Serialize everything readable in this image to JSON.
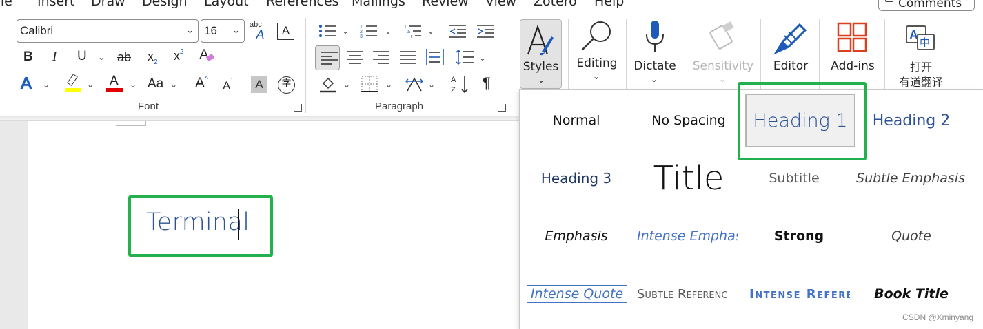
{
  "tabs": [
    "File",
    "Insert",
    "Draw",
    "Design",
    "Layout",
    "References",
    "Mailings",
    "Review",
    "View",
    "Zotero",
    "Help"
  ],
  "comments_label": "Comments",
  "font": {
    "name": "Calibri",
    "size": "16",
    "group_label": "Font",
    "bold": "B",
    "italic": "I",
    "underline": "U",
    "strike": "ab",
    "subscript": "x",
    "subscript_mark": "2",
    "superscript": "x",
    "superscript_mark": "2",
    "change_case": "Aa",
    "grow": "A",
    "shrink": "A",
    "char_shading": "A",
    "enclose": "字",
    "clear_format": "A",
    "text_effects": "A",
    "font_color": "A",
    "phonetic_top": "abc",
    "phonetic_bottom": "A",
    "char_border": "A"
  },
  "paragraph": {
    "group_label": "Paragraph",
    "show_marks": "¶"
  },
  "big_buttons": {
    "styles": "Styles",
    "editing": "Editing",
    "dictate": "Dictate",
    "sensitivity": "Sensitivity",
    "editor": "Editor",
    "addins": "Add-ins",
    "translate_line1": "打开",
    "translate_line2": "有道翻译"
  },
  "colors": {
    "highlight_box": "#22b14c",
    "heading_blue": "#2f5496",
    "highlighter": "#ffff00",
    "font_color_bar": "#e00000",
    "accent_blue": "#1e5bb8"
  },
  "document": {
    "text": "Terminal"
  },
  "gallery": {
    "items": [
      "Normal",
      "No Spacing",
      "Heading 1",
      "Heading 2",
      "Heading 3",
      "Title",
      "Subtitle",
      "Subtle Emphasis",
      "Emphasis",
      "Intense Emphasi",
      "Strong",
      "Quote",
      "Intense Quote",
      "Subtle Referenc",
      "Intense Referen",
      "Book Title"
    ],
    "selected": "Heading 1",
    "watermark": "CSDN @Xminyang"
  }
}
